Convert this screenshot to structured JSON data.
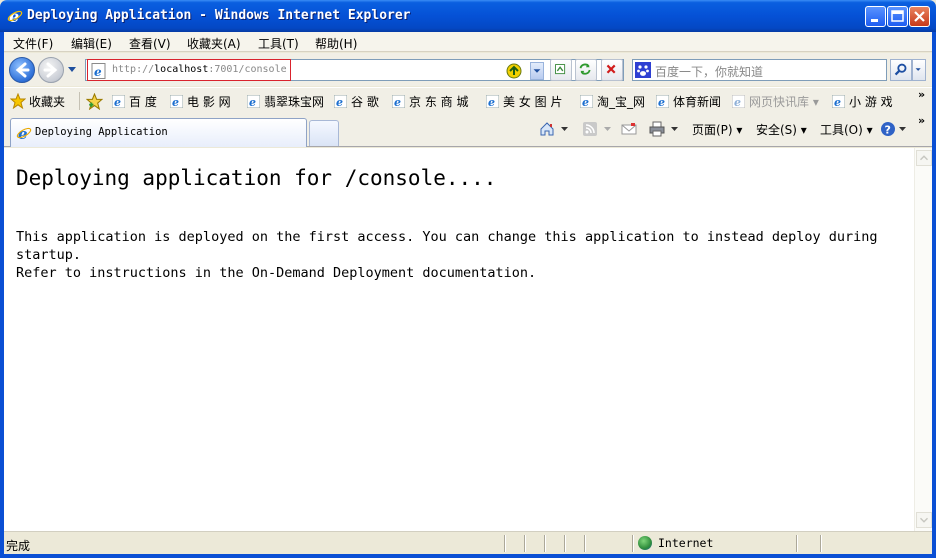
{
  "window": {
    "title": "Deploying Application - Windows Internet Explorer"
  },
  "menu": [
    "文件(F)",
    "编辑(E)",
    "查看(V)",
    "收藏夹(A)",
    "工具(T)",
    "帮助(H)"
  ],
  "address": {
    "prefix": "http://",
    "host": "localhost",
    "rest": ":7001/console"
  },
  "search": {
    "placeholder": "百度一下，你就知道"
  },
  "favorites": {
    "label": "收藏夹",
    "items": [
      "百 度",
      "电 影 网",
      "翡翠珠宝网",
      "谷 歌",
      "京 东 商 城",
      "美 女 图 片",
      "淘_宝_网",
      "体育新闻",
      "网页快讯库",
      "小 游 戏"
    ]
  },
  "tab": {
    "label": "Deploying Application"
  },
  "commands": {
    "page": "页面(P)",
    "safety": "安全(S)",
    "tools": "工具(O)"
  },
  "page": {
    "heading": "Deploying application for /console....",
    "line1": "This application is deployed on the first access. You can change this application to instead deploy during",
    "line2": "startup.",
    "line3": "Refer to instructions in the On-Demand Deployment documentation."
  },
  "status": {
    "text": "完成",
    "zone": "Internet"
  },
  "icons": {
    "app": "ie-icon",
    "back": "back-arrow-icon",
    "forward": "forward-arrow-icon",
    "refresh": "refresh-icon",
    "stop": "stop-icon",
    "home": "home-icon",
    "feeds": "rss-icon",
    "mail": "mail-icon",
    "print": "print-icon",
    "help": "help-icon",
    "search": "magnifier-icon"
  }
}
